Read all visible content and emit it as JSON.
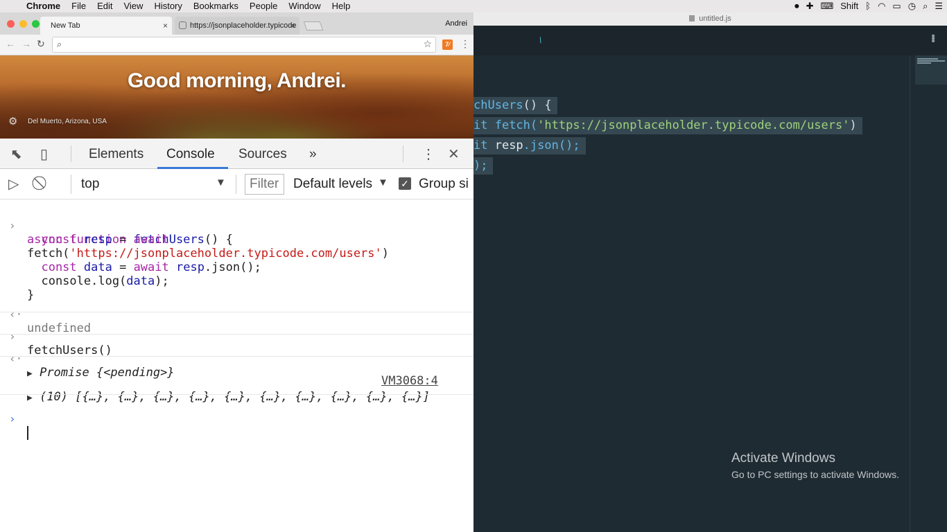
{
  "menubar": {
    "app": "Chrome",
    "items": [
      "File",
      "Edit",
      "View",
      "History",
      "Bookmarks",
      "People",
      "Window",
      "Help"
    ],
    "status_shift": "Shift"
  },
  "chrome": {
    "tabs": [
      {
        "label": "New Tab",
        "active": true
      },
      {
        "label": "https://jsonplaceholder.typicode",
        "active": false
      }
    ],
    "profile": "Andrei",
    "ntp": {
      "greeting": "Good morning, Andrei.",
      "location": "Del Muerto, Arizona, USA"
    }
  },
  "devtools": {
    "tabs": [
      "Elements",
      "Console",
      "Sources"
    ],
    "more_tabs": "»",
    "active_tab": "Console",
    "context": "top",
    "filter_placeholder": "Filter",
    "levels": "Default levels",
    "group_label": "Group si"
  },
  "console": {
    "entry1": {
      "l1a": "async function ",
      "l1b": "fetchUsers",
      "l1c": "() {",
      "l2a": "  const ",
      "l2b": "resp",
      "l2c": " = ",
      "l2d": "await",
      "l3a": "fetch(",
      "l3b": "'https://jsonplaceholder.typicode.com/users'",
      "l3c": ")",
      "l4a": "  const ",
      "l4b": "data",
      "l4c": " = ",
      "l4d": "await ",
      "l4e": "resp",
      "l4f": ".json();",
      "l5a": "  console.log(",
      "l5b": "data",
      "l5c": ");",
      "l6": "}"
    },
    "result1": "undefined",
    "entry2": "fetchUsers()",
    "result2": "Promise {<pending>}",
    "vm_link": "VM3068:4",
    "log_output": "(10) [{…}, {…}, {…}, {…}, {…}, {…}, {…}, {…}, {…}, {…}]"
  },
  "editor": {
    "filename": "untitled.js",
    "lines": [
      {
        "a": "chUsers",
        "b": "() {"
      },
      {
        "a": "it ",
        "b": "fetch(",
        "c": "'https://jsonplaceholder.typicode.com/users'",
        "d": ")"
      },
      {
        "a": "it ",
        "b": "resp",
        "c": ".json();"
      },
      {
        "a": ");"
      }
    ]
  },
  "watermark": {
    "title": "Activate Windows",
    "subtitle": "Go to PC settings to activate Windows."
  }
}
